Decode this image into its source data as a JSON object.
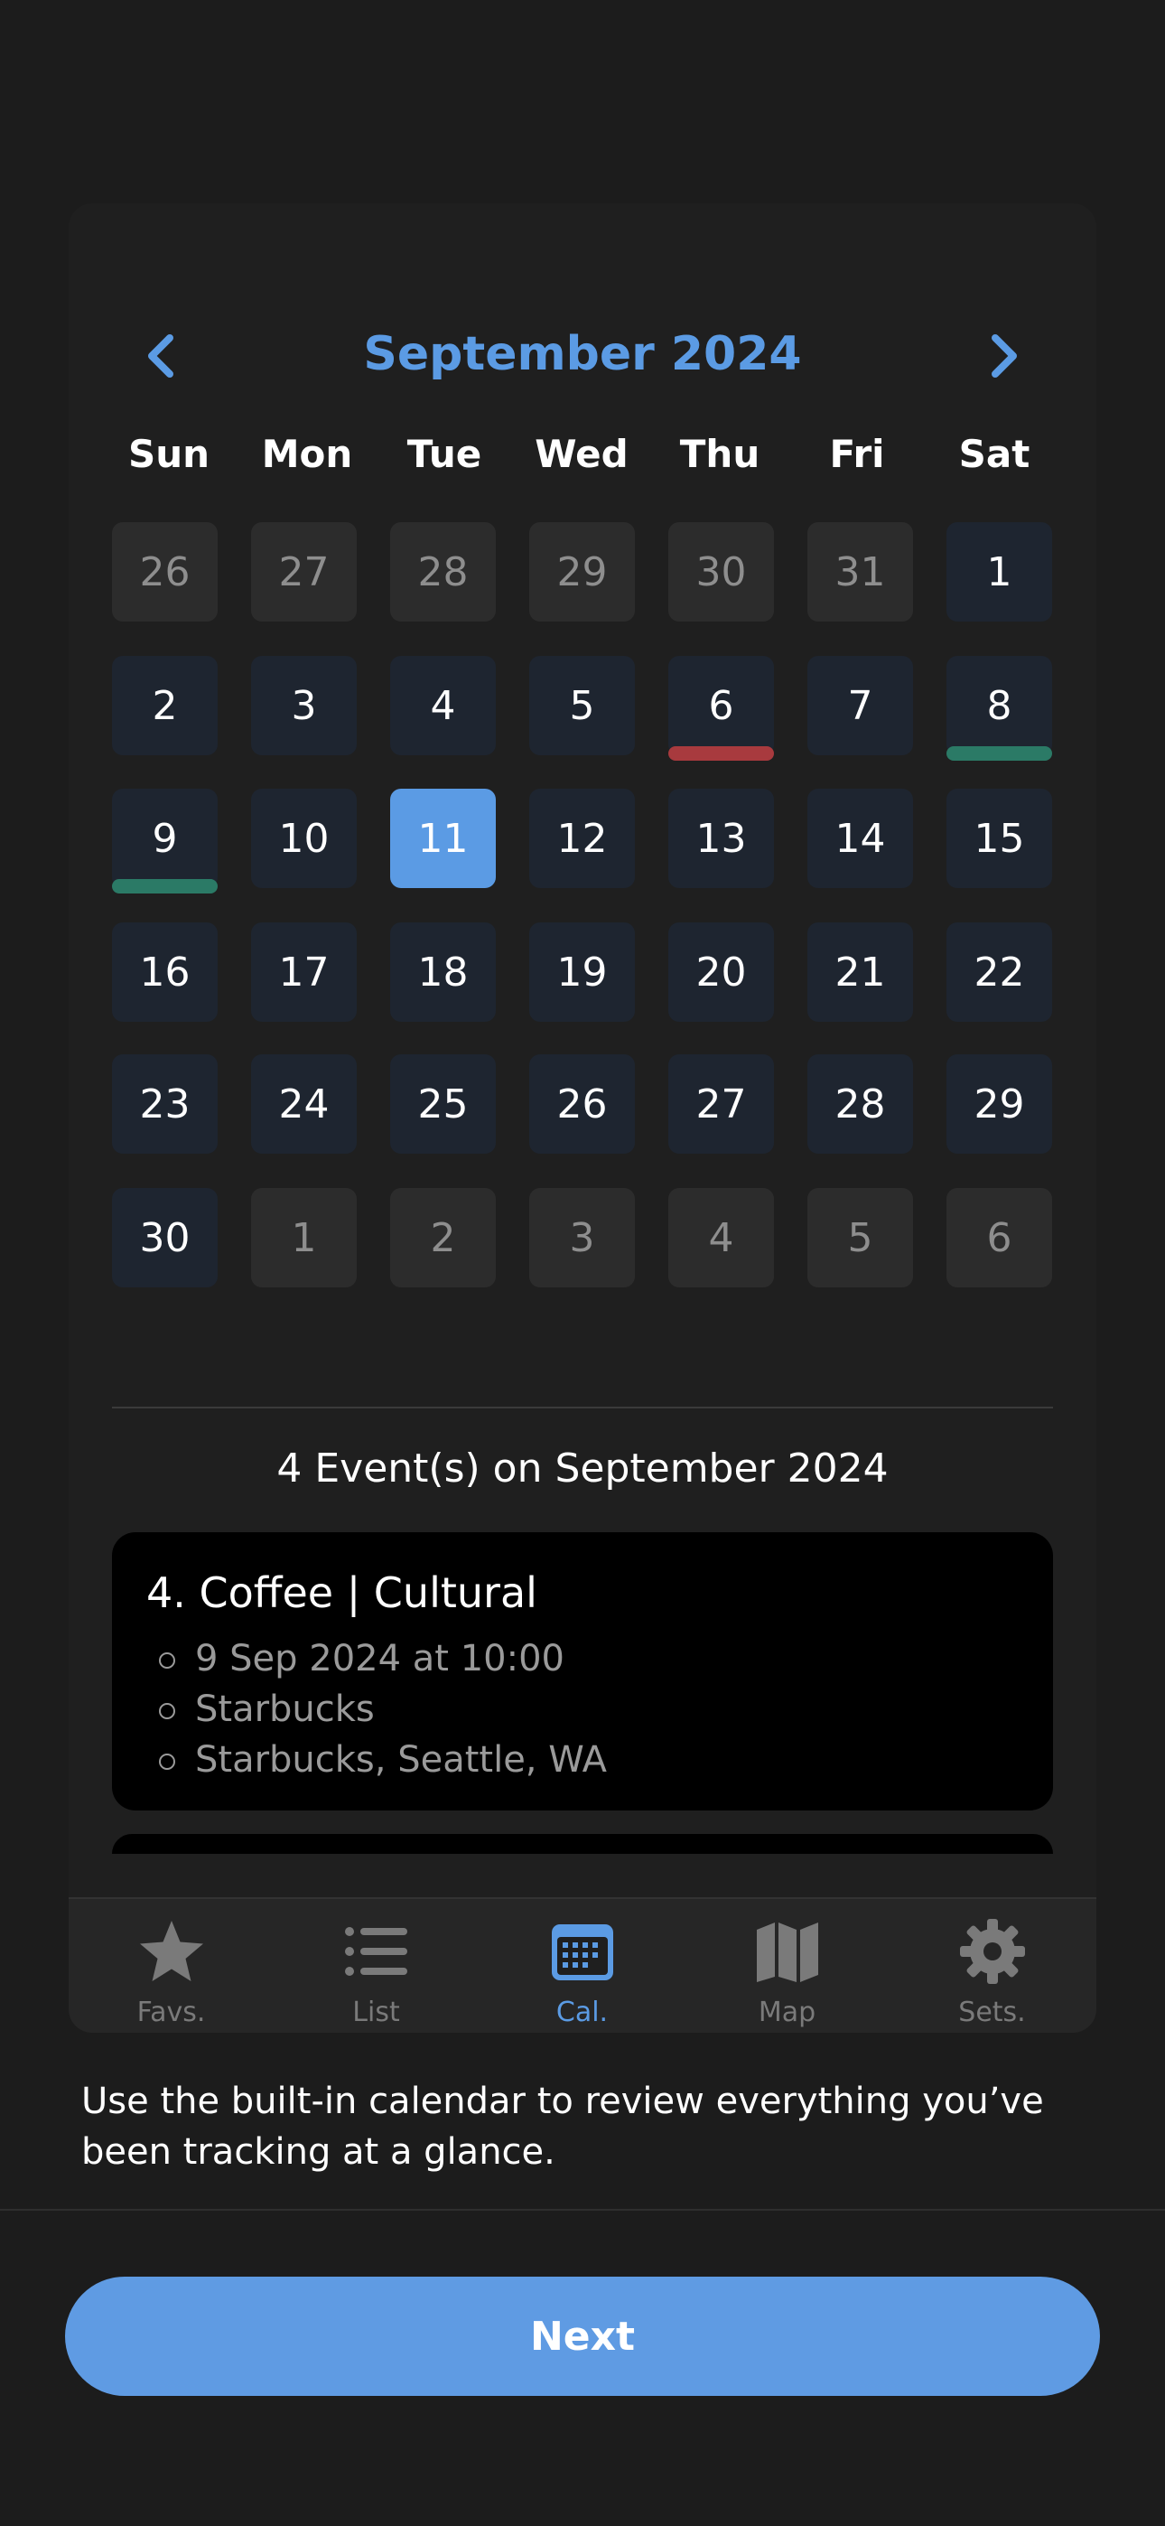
{
  "calendar": {
    "month_title": "September 2024",
    "prev_icon": "chevron-left-icon",
    "next_icon": "chevron-right-icon",
    "weekdays": [
      "Sun",
      "Mon",
      "Tue",
      "Wed",
      "Thu",
      "Fri",
      "Sat"
    ],
    "weeks": [
      [
        {
          "d": "26",
          "state": "muted"
        },
        {
          "d": "27",
          "state": "muted"
        },
        {
          "d": "28",
          "state": "muted"
        },
        {
          "d": "29",
          "state": "muted"
        },
        {
          "d": "30",
          "state": "muted"
        },
        {
          "d": "31",
          "state": "muted"
        },
        {
          "d": "1",
          "state": "normal"
        }
      ],
      [
        {
          "d": "2",
          "state": "normal"
        },
        {
          "d": "3",
          "state": "normal"
        },
        {
          "d": "4",
          "state": "normal"
        },
        {
          "d": "5",
          "state": "normal"
        },
        {
          "d": "6",
          "state": "normal",
          "mark": "#a83a3e"
        },
        {
          "d": "7",
          "state": "normal"
        },
        {
          "d": "8",
          "state": "normal",
          "mark": "#2b7a66"
        }
      ],
      [
        {
          "d": "9",
          "state": "normal",
          "mark": "#2b7a66"
        },
        {
          "d": "10",
          "state": "normal"
        },
        {
          "d": "11",
          "state": "today"
        },
        {
          "d": "12",
          "state": "normal"
        },
        {
          "d": "13",
          "state": "normal"
        },
        {
          "d": "14",
          "state": "normal"
        },
        {
          "d": "15",
          "state": "normal"
        }
      ],
      [
        {
          "d": "16",
          "state": "normal"
        },
        {
          "d": "17",
          "state": "normal"
        },
        {
          "d": "18",
          "state": "normal"
        },
        {
          "d": "19",
          "state": "normal"
        },
        {
          "d": "20",
          "state": "normal"
        },
        {
          "d": "21",
          "state": "normal"
        },
        {
          "d": "22",
          "state": "normal"
        }
      ],
      [
        {
          "d": "23",
          "state": "normal"
        },
        {
          "d": "24",
          "state": "normal"
        },
        {
          "d": "25",
          "state": "normal"
        },
        {
          "d": "26",
          "state": "normal"
        },
        {
          "d": "27",
          "state": "normal"
        },
        {
          "d": "28",
          "state": "normal"
        },
        {
          "d": "29",
          "state": "normal"
        }
      ],
      [
        {
          "d": "30",
          "state": "normal"
        },
        {
          "d": "1",
          "state": "muted"
        },
        {
          "d": "2",
          "state": "muted"
        },
        {
          "d": "3",
          "state": "muted"
        },
        {
          "d": "4",
          "state": "muted"
        },
        {
          "d": "5",
          "state": "muted"
        },
        {
          "d": "6",
          "state": "muted"
        }
      ]
    ]
  },
  "events": {
    "heading": "4 Event(s) on September 2024",
    "first": {
      "title": "4. Coffee | Cultural",
      "lines": [
        "9 Sep 2024 at 10:00",
        "Starbucks",
        "Starbucks, Seattle, WA"
      ]
    }
  },
  "tabbar": {
    "tabs": [
      {
        "label": "Favs.",
        "icon": "star-icon",
        "active": false
      },
      {
        "label": "List",
        "icon": "list-icon",
        "active": false
      },
      {
        "label": "Cal.",
        "icon": "calendar-icon",
        "active": true
      },
      {
        "label": "Map",
        "icon": "map-icon",
        "active": false
      },
      {
        "label": "Sets.",
        "icon": "gear-icon",
        "active": false
      }
    ]
  },
  "onboarding": {
    "caption": "Use the built-in calendar to review everything you’ve been tracking at a glance.",
    "next_label": "Next"
  },
  "colors": {
    "accent": "#5b9be4",
    "background": "#1c1c1c",
    "day_cell": "#1e2530",
    "muted_cell": "#2c2c2c",
    "event_red": "#a83a3e",
    "event_green": "#2b7a66"
  }
}
